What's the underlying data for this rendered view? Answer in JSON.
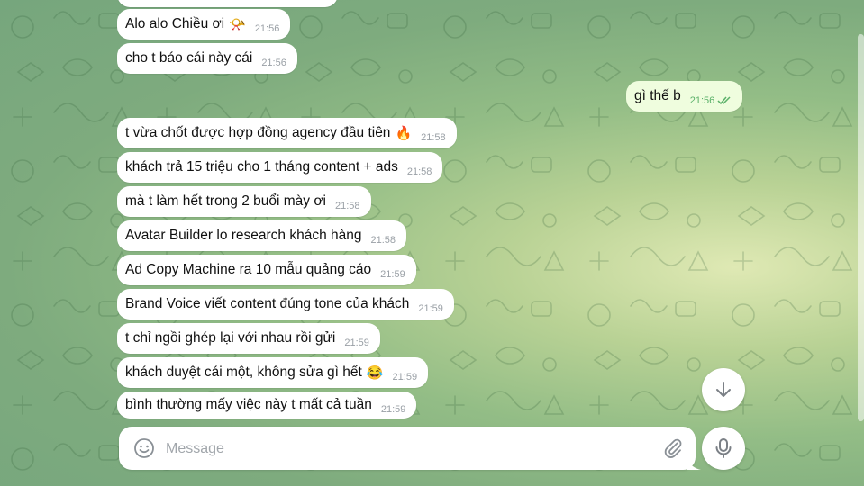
{
  "colors": {
    "incoming_bubble": "#ffffff",
    "outgoing_bubble": "#effdde",
    "outgoing_time": "#5bb169",
    "background": "#93bd86"
  },
  "messages": [
    {
      "direction": "in",
      "text": "Alo alo Chiều ơi",
      "emoji": "📯",
      "time": "21:56"
    },
    {
      "direction": "in",
      "text": "cho t báo cái này cái",
      "time": "21:56"
    },
    {
      "direction": "out",
      "text": "gì thế b",
      "time": "21:56",
      "status_icon": "double-check-icon"
    },
    {
      "direction": "in",
      "text": "t vừa chốt được hợp đồng agency đầu tiên",
      "emoji": "🔥",
      "time": "21:58"
    },
    {
      "direction": "in",
      "text": "khách trả 15 triệu cho 1 tháng content + ads",
      "time": "21:58"
    },
    {
      "direction": "in",
      "text": "mà t làm hết trong 2 buổi mày ơi",
      "time": "21:58"
    },
    {
      "direction": "in",
      "text": "Avatar Builder lo research khách hàng",
      "time": "21:58"
    },
    {
      "direction": "in",
      "text": "Ad Copy Machine ra 10 mẫu quảng cáo",
      "time": "21:59"
    },
    {
      "direction": "in",
      "text": "Brand Voice viết content đúng tone của khách",
      "time": "21:59"
    },
    {
      "direction": "in",
      "text": "t chỉ ngồi ghép lại với nhau rồi gửi",
      "time": "21:59"
    },
    {
      "direction": "in",
      "text": "khách duyệt cái một, không sửa gì hết",
      "emoji": "😂",
      "time": "21:59"
    },
    {
      "direction": "in",
      "text": "bình thường mấy việc này t mất cả tuần",
      "time": "21:59"
    }
  ],
  "composer": {
    "placeholder": "Message",
    "value": "",
    "emoji_icon": "smile-icon",
    "attach_icon": "paperclip-icon",
    "send_icon": "microphone-icon"
  },
  "scroll_down_icon": "arrow-down-icon"
}
